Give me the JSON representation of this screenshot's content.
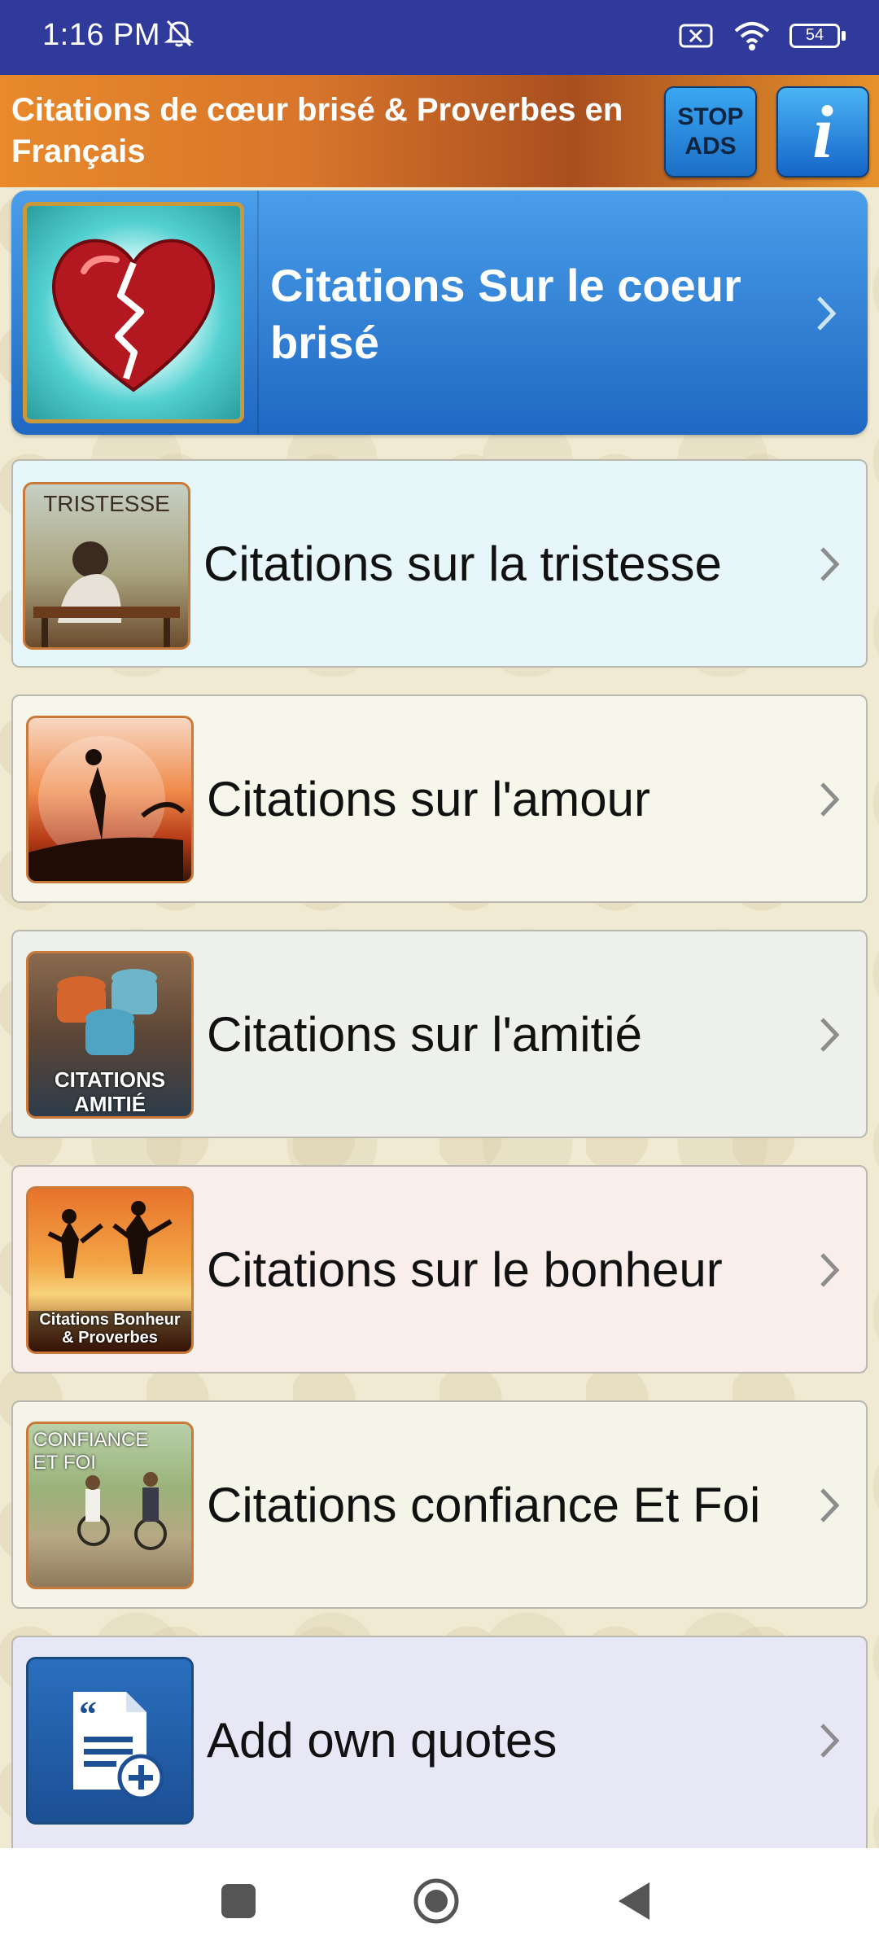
{
  "status_bar": {
    "time": "1:16 PM",
    "battery": "54",
    "icons": [
      "mute-icon",
      "sim-off-icon",
      "wifi-icon",
      "battery-icon"
    ]
  },
  "app_bar": {
    "title": "Citations de cœur brisé & Proverbes en Français",
    "stop_ads_line1": "STOP",
    "stop_ads_line2": "ADS",
    "info_label": "i",
    "color_accent": "#2f3a9b"
  },
  "list": {
    "featured": {
      "label": "Citations Sur le coeur brisé",
      "icon": "broken-heart-icon"
    },
    "items": [
      {
        "label": "Citations sur la tristesse",
        "thumb_caption": "TRISTESSE",
        "bg": "#e6f6f9"
      },
      {
        "label": "Citations sur l'amour",
        "thumb_caption": "",
        "bg": "#f6f6ea"
      },
      {
        "label": "Citations sur l'amitié",
        "thumb_caption": "CITATIONS AMITIÉ",
        "bg": "#eef0ec"
      },
      {
        "label": "Citations sur le bonheur",
        "thumb_caption": "Citations Bonheur & Proverbes",
        "bg": "#f9eeea"
      },
      {
        "label": "Citations confiance Et Foi",
        "thumb_caption": "CONFIANCE ET FOI",
        "bg": "#f4f5e8"
      },
      {
        "label": "Add own quotes",
        "thumb_caption": "",
        "bg": "#e7e7f6"
      }
    ]
  }
}
